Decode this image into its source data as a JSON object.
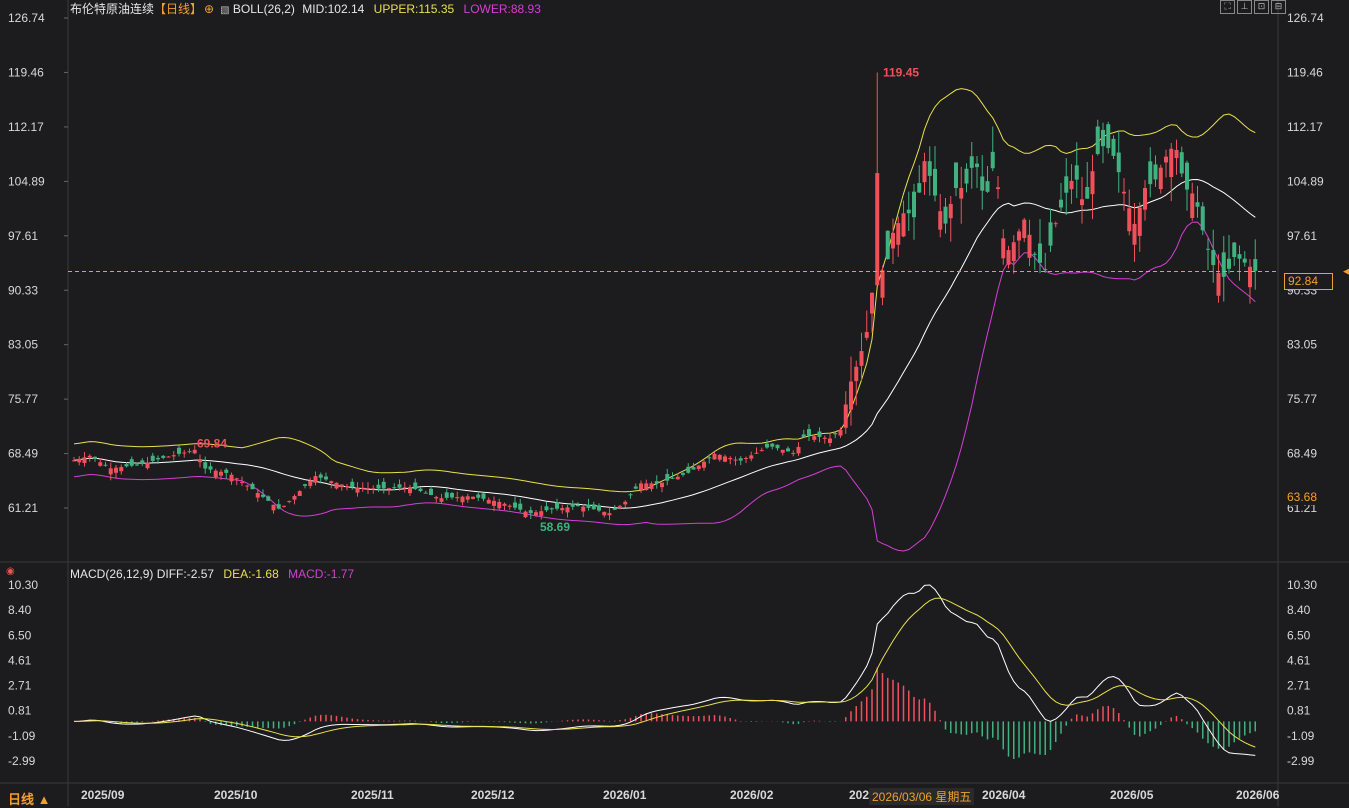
{
  "header": {
    "instrument": "布伦特原油连续",
    "period_tag": "【日线】",
    "boll_label": "BOLL(26,2)",
    "boll_mid": "MID:102.14",
    "boll_upper": "UPPER:115.35",
    "boll_lower": "LOWER:88.93"
  },
  "macd_header": {
    "label": "MACD(26,12,9)",
    "diff": "DIFF:-2.57",
    "dea": "DEA:-1.68",
    "macd": "MACD:-1.77"
  },
  "footer": {
    "period_button": "日线 ▲",
    "crosshair_date": "2026/03/06 星期五"
  },
  "price_boxes": {
    "current": "92.84",
    "highlight": "63.68"
  },
  "colors": {
    "up": "#f0505a",
    "down": "#3fb27f",
    "mid": "#ffffff",
    "upper": "#e8e04a",
    "lower": "#d43fd4",
    "diff": "#ffffff",
    "dea": "#e8e04a",
    "accent": "#f0a030"
  },
  "chart_data": [
    {
      "type": "candlestick",
      "title": "布伦特原油连续",
      "ylim": [
        54.0,
        126.74
      ],
      "y_ticks": [
        "126.74",
        "119.46",
        "112.17",
        "104.89",
        "97.61",
        "90.33",
        "83.05",
        "75.77",
        "68.49",
        "61.21"
      ],
      "x_ticks": [
        "2025/09",
        "2025/10",
        "2025/11",
        "2025/12",
        "2026/01",
        "2026/02",
        "2026/03",
        "2026/04",
        "2026/05",
        "2026/06"
      ],
      "current_price": 92.84,
      "annotations": [
        {
          "text": "119.45",
          "kind": "max"
        },
        {
          "text": "69.84",
          "kind": "local-high"
        },
        {
          "text": "58.69",
          "kind": "min"
        }
      ],
      "series_close": {
        "anchors_by_month": [
          {
            "month": "2025/08-end",
            "close": 67.5
          },
          {
            "month": "2025/09",
            "close": 67.0
          },
          {
            "month": "2025/10",
            "close": 62.5
          },
          {
            "month": "2025/11",
            "close": 64.0
          },
          {
            "month": "2025/12",
            "close": 61.0
          },
          {
            "month": "2026/01",
            "close": 64.0
          },
          {
            "month": "2026/02",
            "close": 70.5
          },
          {
            "month": "2026/03",
            "close": 101.0
          },
          {
            "month": "2026/04",
            "close": 96.0
          },
          {
            "month": "2026/05",
            "close": 103.0
          },
          {
            "month": "2026/06",
            "close": 92.84
          }
        ]
      },
      "indicators": {
        "BOLL(26,2)": {
          "MID": 102.14,
          "UPPER": 115.35,
          "LOWER": 88.93
        }
      }
    },
    {
      "type": "bar+line",
      "title": "MACD(26,12,9)",
      "ylim": [
        -4.0,
        10.3
      ],
      "y_ticks": [
        "10.30",
        "8.40",
        "6.50",
        "4.61",
        "2.71",
        "0.81",
        "-1.09",
        "-2.99"
      ],
      "last": {
        "DIFF": -2.57,
        "DEA": -1.68,
        "MACD": -1.77
      },
      "peaks": {
        "DIFF_max": 10.3,
        "DEA_max": 8.4
      }
    }
  ]
}
